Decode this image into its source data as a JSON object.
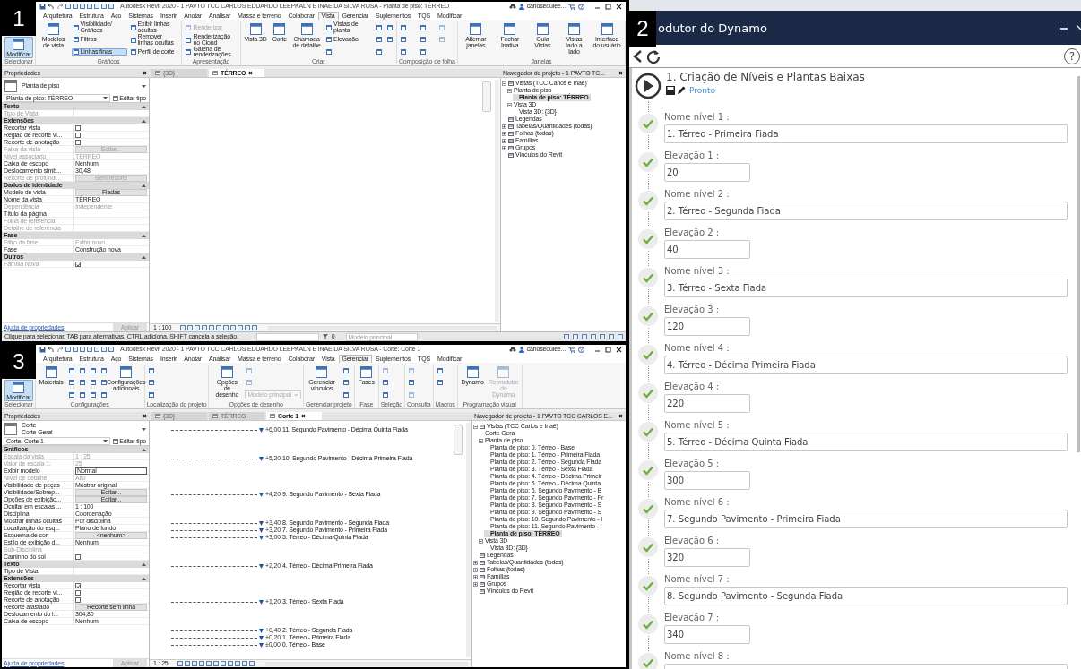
{
  "panels": [
    {
      "kind": "revit",
      "badge": "1",
      "title_bar": {
        "title": "Autodesk Revit 2020 - 1 PAVTO TCC CARLOS EDUARDO LEEPKALN E INAE DA SILVA ROSA - Planta de piso: TÉRREO",
        "user": "carloseduiee..."
      },
      "ribbon_tabs": [
        {
          "label": "Arquitetura",
          "selected": false
        },
        {
          "label": "Estrutura",
          "selected": false
        },
        {
          "label": "Aço",
          "selected": false
        },
        {
          "label": "Sistemas",
          "selected": false
        },
        {
          "label": "Inserir",
          "selected": false
        },
        {
          "label": "Anotar",
          "selected": false
        },
        {
          "label": "Analisar",
          "selected": false
        },
        {
          "label": "Massa e terreno",
          "selected": false
        },
        {
          "label": "Colaborar",
          "selected": false
        },
        {
          "label": "Vista",
          "selected": true
        },
        {
          "label": "Gerenciar",
          "selected": false
        },
        {
          "label": "Suplementos",
          "selected": false
        },
        {
          "label": "TQS",
          "selected": false
        },
        {
          "label": "Modificar",
          "selected": false
        }
      ],
      "ribbon_groups": [
        {
          "label": "Selecionar",
          "items": [
            {
              "kind": "large",
              "label": "Modificar",
              "on": true,
              "disabled": false
            }
          ]
        },
        {
          "label": "Gráficos",
          "items": [
            {
              "kind": "large",
              "label": "Modelos de vista",
              "on": false,
              "disabled": false
            },
            {
              "kind": "small",
              "label": "Visibilidade/ Gráficos",
              "on": false,
              "disabled": false
            },
            {
              "kind": "small",
              "label": "Filtros",
              "on": false,
              "disabled": false
            },
            {
              "kind": "small",
              "label": "Linhas finas",
              "on": true,
              "disabled": false
            },
            {
              "kind": "small",
              "label": "Exibir linhas ocultas",
              "on": false,
              "disabled": false
            },
            {
              "kind": "small",
              "label": "Remover linhas ocultas",
              "on": false,
              "disabled": false
            },
            {
              "kind": "small",
              "label": "Perfil de corte",
              "on": false,
              "disabled": false
            }
          ]
        },
        {
          "label": "Apresentação",
          "items": [
            {
              "kind": "small",
              "label": "Renderizar",
              "on": false,
              "disabled": true
            },
            {
              "kind": "small",
              "label": "Renderização no Cloud",
              "on": false,
              "disabled": false
            },
            {
              "kind": "small",
              "label": "Galeria de renderizações",
              "on": false,
              "disabled": false
            }
          ]
        },
        {
          "label": "Criar",
          "items": [
            {
              "kind": "large",
              "label": "Vista 3D",
              "on": false,
              "disabled": false
            },
            {
              "kind": "large",
              "label": "Corte",
              "on": false,
              "disabled": false
            },
            {
              "kind": "large",
              "label": "Chamada de detalhe",
              "on": false,
              "disabled": false
            },
            {
              "kind": "small",
              "label": "Vistas de planta",
              "on": false,
              "disabled": false
            },
            {
              "kind": "small",
              "label": "Elevação",
              "on": false,
              "disabled": false
            },
            {
              "kind": "icon",
              "on": false,
              "disabled": false
            },
            {
              "kind": "icon",
              "on": false,
              "disabled": false
            },
            {
              "kind": "icon",
              "on": false,
              "disabled": false
            },
            {
              "kind": "icon",
              "on": false,
              "disabled": false
            },
            {
              "kind": "icon",
              "on": false,
              "disabled": false
            },
            {
              "kind": "icon",
              "on": false,
              "disabled": false
            }
          ]
        },
        {
          "label": "Composição de folha",
          "items": [
            {
              "kind": "icon",
              "on": false,
              "disabled": false
            },
            {
              "kind": "icon",
              "on": false,
              "disabled": false
            },
            {
              "kind": "icon",
              "on": false,
              "disabled": false
            },
            {
              "kind": "icon",
              "on": false,
              "disabled": false
            },
            {
              "kind": "icon",
              "on": false,
              "disabled": false
            },
            {
              "kind": "icon",
              "on": false,
              "disabled": false
            },
            {
              "kind": "icon",
              "on": false,
              "disabled": true
            },
            {
              "kind": "icon",
              "on": false,
              "disabled": true
            }
          ]
        },
        {
          "label": "Janelas",
          "items": [
            {
              "kind": "large",
              "label": "Alternar janelas",
              "on": false,
              "disabled": false
            },
            {
              "kind": "large",
              "label": "Fechar Inativa",
              "on": false,
              "disabled": false
            },
            {
              "kind": "large",
              "label": "Guia Vistas",
              "on": false,
              "disabled": false
            },
            {
              "kind": "large",
              "label": "Vistas lado a lado",
              "on": false,
              "disabled": false
            },
            {
              "kind": "large",
              "label": "Interface do usuário",
              "on": false,
              "disabled": false
            }
          ]
        }
      ],
      "properties": {
        "title": "Propriedades",
        "type_name": "Planta de piso",
        "selector": "Planta de piso: TÉRREO",
        "edit_type": "Editar tipo",
        "rows": [
          {
            "kind": "section",
            "label": "Texto"
          },
          {
            "kind": "text",
            "label": "Tipo de Vista",
            "disabled": true
          },
          {
            "kind": "section",
            "label": "Extensões"
          },
          {
            "kind": "checkbox",
            "label": "Recortar vista",
            "checked": false,
            "disabled": false
          },
          {
            "kind": "checkbox",
            "label": "Região de recorte vi...",
            "checked": false,
            "disabled": false
          },
          {
            "kind": "checkbox",
            "label": "Recorte de anotação",
            "checked": false,
            "disabled": false
          },
          {
            "kind": "button",
            "label": "Faixa da vista",
            "value": "Editar...",
            "disabled": true
          },
          {
            "kind": "text",
            "label": "Nível associado",
            "value": "TÉRREO",
            "disabled": true
          },
          {
            "kind": "text",
            "label": "Caixa de escopo",
            "value": "Nenhum",
            "disabled": false
          },
          {
            "kind": "text",
            "label": "Deslocamento simb...",
            "value": "30,48",
            "disabled": false
          },
          {
            "kind": "button",
            "label": "Recorte de profundi...",
            "value": "Sem recorte",
            "disabled": true
          },
          {
            "kind": "section",
            "label": "Dados de identidade"
          },
          {
            "kind": "button",
            "label": "Modelo de vista",
            "value": "Fiadas",
            "disabled": false
          },
          {
            "kind": "text",
            "label": "Nome da vista",
            "value": "TÉRREO",
            "disabled": false
          },
          {
            "kind": "text",
            "label": "Dependência",
            "value": "Independente",
            "disabled": true
          },
          {
            "kind": "text",
            "label": "Título da página",
            "disabled": false
          },
          {
            "kind": "text",
            "label": "Folha de referência",
            "disabled": true
          },
          {
            "kind": "text",
            "label": "Detalhe de referência",
            "disabled": true
          },
          {
            "kind": "section",
            "label": "Fase"
          },
          {
            "kind": "text",
            "label": "Filtro da fase",
            "value": "Exibir novo",
            "disabled": true
          },
          {
            "kind": "text",
            "label": "Fase",
            "value": "Construção nova",
            "disabled": false
          },
          {
            "kind": "section",
            "label": "Outros"
          },
          {
            "kind": "checkbox",
            "label": "Família Nova",
            "checked": true,
            "disabled": true
          }
        ],
        "help": "Ajuda de propriedades",
        "apply": "Aplicar"
      },
      "view_tabs": [
        {
          "label": "{3D}",
          "selected": false
        },
        {
          "label": "TÉRREO",
          "selected": true
        }
      ],
      "view": {
        "scale": "1 : 100"
      },
      "navigator": {
        "title": "Navegador de projeto - 1 PAVTO TC...",
        "tree": [
          {
            "label": "Vistas (TCC Carlos e Inaê)",
            "expanded": true,
            "selected": false,
            "children": [
              {
                "label": "Planta de piso",
                "expanded": true,
                "selected": false,
                "children": [
                  {
                    "label": "Planta de piso: TÉRREO",
                    "selected": true
                  }
                ]
              },
              {
                "label": "Vista 3D",
                "expanded": true,
                "selected": false,
                "children": [
                  {
                    "label": "Vista 3D: {3D}",
                    "selected": false
                  }
                ]
              }
            ]
          },
          {
            "label": "Legendas",
            "selected": false
          },
          {
            "label": "Tabelas/Quantidades (todas)",
            "expanded": false,
            "selected": false
          },
          {
            "label": "Folhas (todas)",
            "expanded": false,
            "selected": false
          },
          {
            "label": "Famílias",
            "expanded": false,
            "selected": false
          },
          {
            "label": "Grupos",
            "expanded": false,
            "selected": false
          },
          {
            "label": "Vínculos do Revit",
            "selected": false
          }
        ]
      },
      "status_bar": {
        "message": "Clique para selecionar, TAB para alternativas, CTRL adiciona, SHIFT cancela a seleção.",
        "count": "0",
        "model": "Modelo principal"
      }
    },
    {
      "kind": "dynamo",
      "badge": "2",
      "title": "odutor do Dynamo",
      "help": "?",
      "script": {
        "title": "1. Criação de Níveis e Plantas Baixas",
        "status": "Pronto"
      },
      "inputs": [
        {
          "label": "Nome nível 1 :",
          "value": "1. Térreo - Primeira Fiada",
          "kind": "text",
          "checked": true
        },
        {
          "label": "Elevação 1 :",
          "value": "20",
          "kind": "number",
          "checked": true
        },
        {
          "label": "Nome nível 2 :",
          "value": "2. Térreo - Segunda Fiada",
          "kind": "text",
          "checked": true
        },
        {
          "label": "Elevação 2 :",
          "value": "40",
          "kind": "number",
          "checked": true
        },
        {
          "label": "Nome nível 3 :",
          "value": "3. Térreo - Sexta Fiada",
          "kind": "text",
          "checked": true
        },
        {
          "label": "Elevação 3 :",
          "value": "120",
          "kind": "number",
          "checked": true
        },
        {
          "label": "Nome nível 4 :",
          "value": "4. Térreo - Décima Primeira Fiada",
          "kind": "text",
          "checked": true
        },
        {
          "label": "Elevação 4 :",
          "value": "220",
          "kind": "number",
          "checked": true
        },
        {
          "label": "Nome nível 5 :",
          "value": "5. Térreo - Décima Quinta Fiada",
          "kind": "text",
          "checked": true
        },
        {
          "label": "Elevação 5 :",
          "value": "300",
          "kind": "number",
          "checked": true
        },
        {
          "label": "Nome nível 6 :",
          "value": "7. Segundo Pavimento - Primeira Fiada",
          "kind": "text",
          "checked": true
        },
        {
          "label": "Elevação 6 :",
          "value": "320",
          "kind": "number",
          "checked": true
        },
        {
          "label": "Nome nível 7 :",
          "value": "8. Segundo Pavimento - Segunda Fiada",
          "kind": "text",
          "checked": true
        },
        {
          "label": "Elevação 7 :",
          "value": "340",
          "kind": "number",
          "checked": true
        },
        {
          "label": "Nome nível 8 :",
          "kind": "text",
          "checked": true
        }
      ]
    },
    {
      "kind": "revit",
      "badge": "3",
      "title_bar": {
        "title": "Autodesk Revit 2020 - 1 PAVTO TCC CARLOS EDUARDO LEEPKALN E INAE DA SILVA ROSA - Corte: Corte 1",
        "user": "carloseduiee..."
      },
      "ribbon_tabs": [
        {
          "label": "Arquitetura",
          "selected": false
        },
        {
          "label": "Estrutura",
          "selected": false
        },
        {
          "label": "Aço",
          "selected": false
        },
        {
          "label": "Sistemas",
          "selected": false
        },
        {
          "label": "Inserir",
          "selected": false
        },
        {
          "label": "Anotar",
          "selected": false
        },
        {
          "label": "Analisar",
          "selected": false
        },
        {
          "label": "Massa e terreno",
          "selected": false
        },
        {
          "label": "Colaborar",
          "selected": false
        },
        {
          "label": "Vista",
          "selected": false
        },
        {
          "label": "Gerenciar",
          "selected": true
        },
        {
          "label": "Suplementos",
          "selected": false
        },
        {
          "label": "TQS",
          "selected": false
        },
        {
          "label": "Modificar",
          "selected": false
        }
      ],
      "ribbon_groups": [
        {
          "label": "Selecionar",
          "items": [
            {
              "kind": "large",
              "label": "Modificar",
              "on": true,
              "disabled": false
            }
          ]
        },
        {
          "label": "Configurações",
          "items": [
            {
              "kind": "large",
              "label": "Materiais",
              "on": false,
              "disabled": false
            },
            {
              "kind": "icon",
              "on": false,
              "disabled": false
            },
            {
              "kind": "icon",
              "on": false,
              "disabled": false
            },
            {
              "kind": "icon",
              "on": false,
              "disabled": false
            },
            {
              "kind": "icon",
              "on": false,
              "disabled": false
            },
            {
              "kind": "icon",
              "on": false,
              "disabled": false
            },
            {
              "kind": "icon",
              "on": false,
              "disabled": false
            },
            {
              "kind": "icon",
              "on": false,
              "disabled": false
            },
            {
              "kind": "icon",
              "on": false,
              "disabled": false
            },
            {
              "kind": "icon",
              "on": false,
              "disabled": false
            },
            {
              "kind": "icon",
              "on": false,
              "disabled": false
            },
            {
              "kind": "icon",
              "on": false,
              "disabled": false
            },
            {
              "kind": "icon",
              "on": false,
              "disabled": false
            },
            {
              "kind": "large",
              "label": "Configurações adicionais",
              "on": false,
              "disabled": false
            }
          ]
        },
        {
          "label": "Localização do projeto",
          "items": [
            {
              "kind": "icon",
              "on": false,
              "disabled": false
            },
            {
              "kind": "icon",
              "on": false,
              "disabled": false
            },
            {
              "kind": "icon",
              "on": false,
              "disabled": false
            }
          ]
        },
        {
          "label": "Opções de desenho",
          "items": [
            {
              "kind": "large",
              "label": "Opções de desenho",
              "on": false,
              "disabled": false
            },
            {
              "kind": "icon",
              "on": false,
              "disabled": true
            },
            {
              "kind": "icon",
              "on": false,
              "disabled": true
            },
            {
              "kind": "dropdown",
              "label": "Modelo principal",
              "on": false,
              "disabled": true
            }
          ]
        },
        {
          "label": "Gerenciar projeto",
          "items": [
            {
              "kind": "large",
              "label": "Gerenciar vínculos",
              "on": false,
              "disabled": false
            },
            {
              "kind": "icon",
              "on": false,
              "disabled": false
            },
            {
              "kind": "icon",
              "on": false,
              "disabled": false
            },
            {
              "kind": "icon",
              "on": false,
              "disabled": false
            }
          ]
        },
        {
          "label": "Fase",
          "items": [
            {
              "kind": "large",
              "label": "Fases",
              "on": false,
              "disabled": false
            }
          ]
        },
        {
          "label": "Seleção",
          "items": [
            {
              "kind": "icon",
              "on": false,
              "disabled": true
            },
            {
              "kind": "icon",
              "on": false,
              "disabled": false
            },
            {
              "kind": "icon",
              "on": false,
              "disabled": false
            }
          ]
        },
        {
          "label": "Consulta",
          "items": [
            {
              "kind": "icon",
              "on": false,
              "disabled": true
            },
            {
              "kind": "icon",
              "on": false,
              "disabled": false
            },
            {
              "kind": "icon",
              "on": false,
              "disabled": true
            }
          ]
        },
        {
          "label": "Macros",
          "items": [
            {
              "kind": "icon",
              "on": false,
              "disabled": false
            },
            {
              "kind": "icon",
              "on": false,
              "disabled": false
            }
          ]
        },
        {
          "label": "Programação visual",
          "items": [
            {
              "kind": "large",
              "label": "Dynamo",
              "on": false,
              "disabled": false
            },
            {
              "kind": "large",
              "label": "Reprodutor do Dynamo",
              "on": false,
              "disabled": true
            }
          ]
        }
      ],
      "properties": {
        "title": "Propriedades",
        "type_name": "Corte",
        "type_sub": "Corte Geral",
        "selector": "Corte: Corte 1",
        "edit_type": "Editar tipo",
        "rows": [
          {
            "kind": "section",
            "label": "Gráficos"
          },
          {
            "kind": "text",
            "label": "Escala da vista",
            "value": "1 : 25",
            "disabled": true
          },
          {
            "kind": "text",
            "label": "Valor de escala    1:",
            "value": "25",
            "disabled": true
          },
          {
            "kind": "field",
            "label": "Exibir modelo",
            "value": "Normal",
            "disabled": false
          },
          {
            "kind": "text",
            "label": "Nível de detalhe",
            "value": "Alto",
            "disabled": true
          },
          {
            "kind": "text",
            "label": "Visibilidade de peças",
            "value": "Mostrar original",
            "disabled": false
          },
          {
            "kind": "button",
            "label": "Visibilidade/Sobrep...",
            "value": "Editar...",
            "disabled": false
          },
          {
            "kind": "button",
            "label": "Opções de exibição...",
            "value": "Editar...",
            "disabled": false
          },
          {
            "kind": "text",
            "label": "Ocultar em escalas ...",
            "value": "1 : 100",
            "disabled": false
          },
          {
            "kind": "text",
            "label": "Disciplina",
            "value": "Coordenação",
            "disabled": false
          },
          {
            "kind": "text",
            "label": "Mostrar linhas ocultas",
            "value": "Por disciplina",
            "disabled": false
          },
          {
            "kind": "text",
            "label": "Localização do esq...",
            "value": "Plano de fundo",
            "disabled": false
          },
          {
            "kind": "button",
            "label": "Esquema de cor",
            "value": "<nenhum>",
            "disabled": false
          },
          {
            "kind": "text",
            "label": "Estilo de exibição d...",
            "value": "Nenhum",
            "disabled": false
          },
          {
            "kind": "text",
            "label": "Sub-Disciplina",
            "disabled": true
          },
          {
            "kind": "checkbox",
            "label": "Caminho do sol",
            "checked": false,
            "disabled": false
          },
          {
            "kind": "section",
            "label": "Texto"
          },
          {
            "kind": "text",
            "label": "Tipo de Vista",
            "disabled": false
          },
          {
            "kind": "section",
            "label": "Extensões"
          },
          {
            "kind": "checkbox",
            "label": "Recortar vista",
            "checked": true,
            "disabled": false
          },
          {
            "kind": "checkbox",
            "label": "Região de recorte vi...",
            "checked": false,
            "disabled": false
          },
          {
            "kind": "checkbox",
            "label": "Recorte de anotação",
            "checked": false,
            "disabled": false
          },
          {
            "kind": "button",
            "label": "Recorte afastado",
            "value": "Recorte sem linha",
            "disabled": false
          },
          {
            "kind": "text",
            "label": "Deslocamento do i...",
            "value": "304,80",
            "disabled": false
          },
          {
            "kind": "text",
            "label": "Caixa de escopo",
            "value": "Nenhum",
            "disabled": false
          }
        ],
        "help": "Ajuda de propriedades",
        "apply": "Aplicar"
      },
      "view_tabs": [
        {
          "label": "{3D}",
          "selected": false
        },
        {
          "label": "TÉRREO",
          "selected": false
        },
        {
          "label": "Corte 1",
          "selected": true
        }
      ],
      "view": {
        "scale": "1 : 25",
        "levels": [
          {
            "elevation": "+6,00",
            "name": "11. Segundo Pavimento - Décima Quinta Fiada"
          },
          {
            "elevation": "+5,20",
            "name": "10. Segundo Pavimento - Décima Primeira Fiada"
          },
          {
            "elevation": "+4,20",
            "name": "9. Segundo Pavimento - Sexta Fiada"
          },
          {
            "elevation": "+3,40",
            "name": "8. Segundo Pavimento - Segunda Fiada"
          },
          {
            "elevation": "+3,20",
            "name": "7. Segundo Pavimento - Primeira Fiada"
          },
          {
            "elevation": "+3,00",
            "name": "5. Térreo - Décima Quinta Fiada"
          },
          {
            "elevation": "+2,20",
            "name": "4. Térreo - Décima Primeira Fiada"
          },
          {
            "elevation": "+1,20",
            "name": "3. Térreo - Sexta Fiada"
          },
          {
            "elevation": "+0,40",
            "name": "2. Térreo - Segunda Fiada"
          },
          {
            "elevation": "+0,20",
            "name": "1. Térreo - Primeira Fiada"
          },
          {
            "elevation": "±0,00",
            "name": "0. Térreo - Base"
          }
        ]
      },
      "navigator": {
        "title": "Navegador de projeto - 1 PAVTO TCC CARLOS E...",
        "tree": [
          {
            "label": "Vistas (TCC Carlos e Inaê)",
            "expanded": true,
            "selected": false,
            "children": [
              {
                "label": "Corte Geral",
                "selected": false
              },
              {
                "label": "Planta de piso",
                "expanded": true,
                "selected": false,
                "children": [
                  {
                    "label": "Planta de piso: 0. Térreo - Base",
                    "selected": false
                  },
                  {
                    "label": "Planta de piso: 1. Térreo - Primeira Fiada",
                    "selected": false
                  },
                  {
                    "label": "Planta de piso: 2. Térreo - Segunda Fiada",
                    "selected": false
                  },
                  {
                    "label": "Planta de piso: 3. Térreo - Sexta Fiada",
                    "selected": false
                  },
                  {
                    "label": "Planta de piso: 4. Térreo - Décima Primeir",
                    "selected": false
                  },
                  {
                    "label": "Planta de piso: 5. Térreo - Décima Quinta",
                    "selected": false
                  },
                  {
                    "label": "Planta de piso: 6. Segundo Pavimento - B",
                    "selected": false
                  },
                  {
                    "label": "Planta de piso: 7. Segundo Pavimento - Pr",
                    "selected": false
                  },
                  {
                    "label": "Planta de piso: 8. Segundo Pavimento - S",
                    "selected": false
                  },
                  {
                    "label": "Planta de piso: 9. Segundo Pavimento - S",
                    "selected": false
                  },
                  {
                    "label": "Planta de piso: 10. Segundo Pavimento - I",
                    "selected": false
                  },
                  {
                    "label": "Planta de piso: 11. Segundo Pavimento - I",
                    "selected": false
                  },
                  {
                    "label": "Planta de piso: TÉRREO",
                    "selected": true
                  }
                ]
              },
              {
                "label": "Vista 3D",
                "expanded": true,
                "selected": false,
                "children": [
                  {
                    "label": "Vista 3D: {3D}",
                    "selected": false
                  }
                ]
              }
            ]
          },
          {
            "label": "Legendas",
            "selected": false
          },
          {
            "label": "Tabelas/Quantidades (todas)",
            "expanded": false,
            "selected": false
          },
          {
            "label": "Folhas (todas)",
            "expanded": false,
            "selected": false
          },
          {
            "label": "Famílias",
            "expanded": false,
            "selected": false
          },
          {
            "label": "Grupos",
            "expanded": false,
            "selected": false
          },
          {
            "label": "Vínculos do Revit",
            "selected": false
          }
        ]
      }
    }
  ]
}
